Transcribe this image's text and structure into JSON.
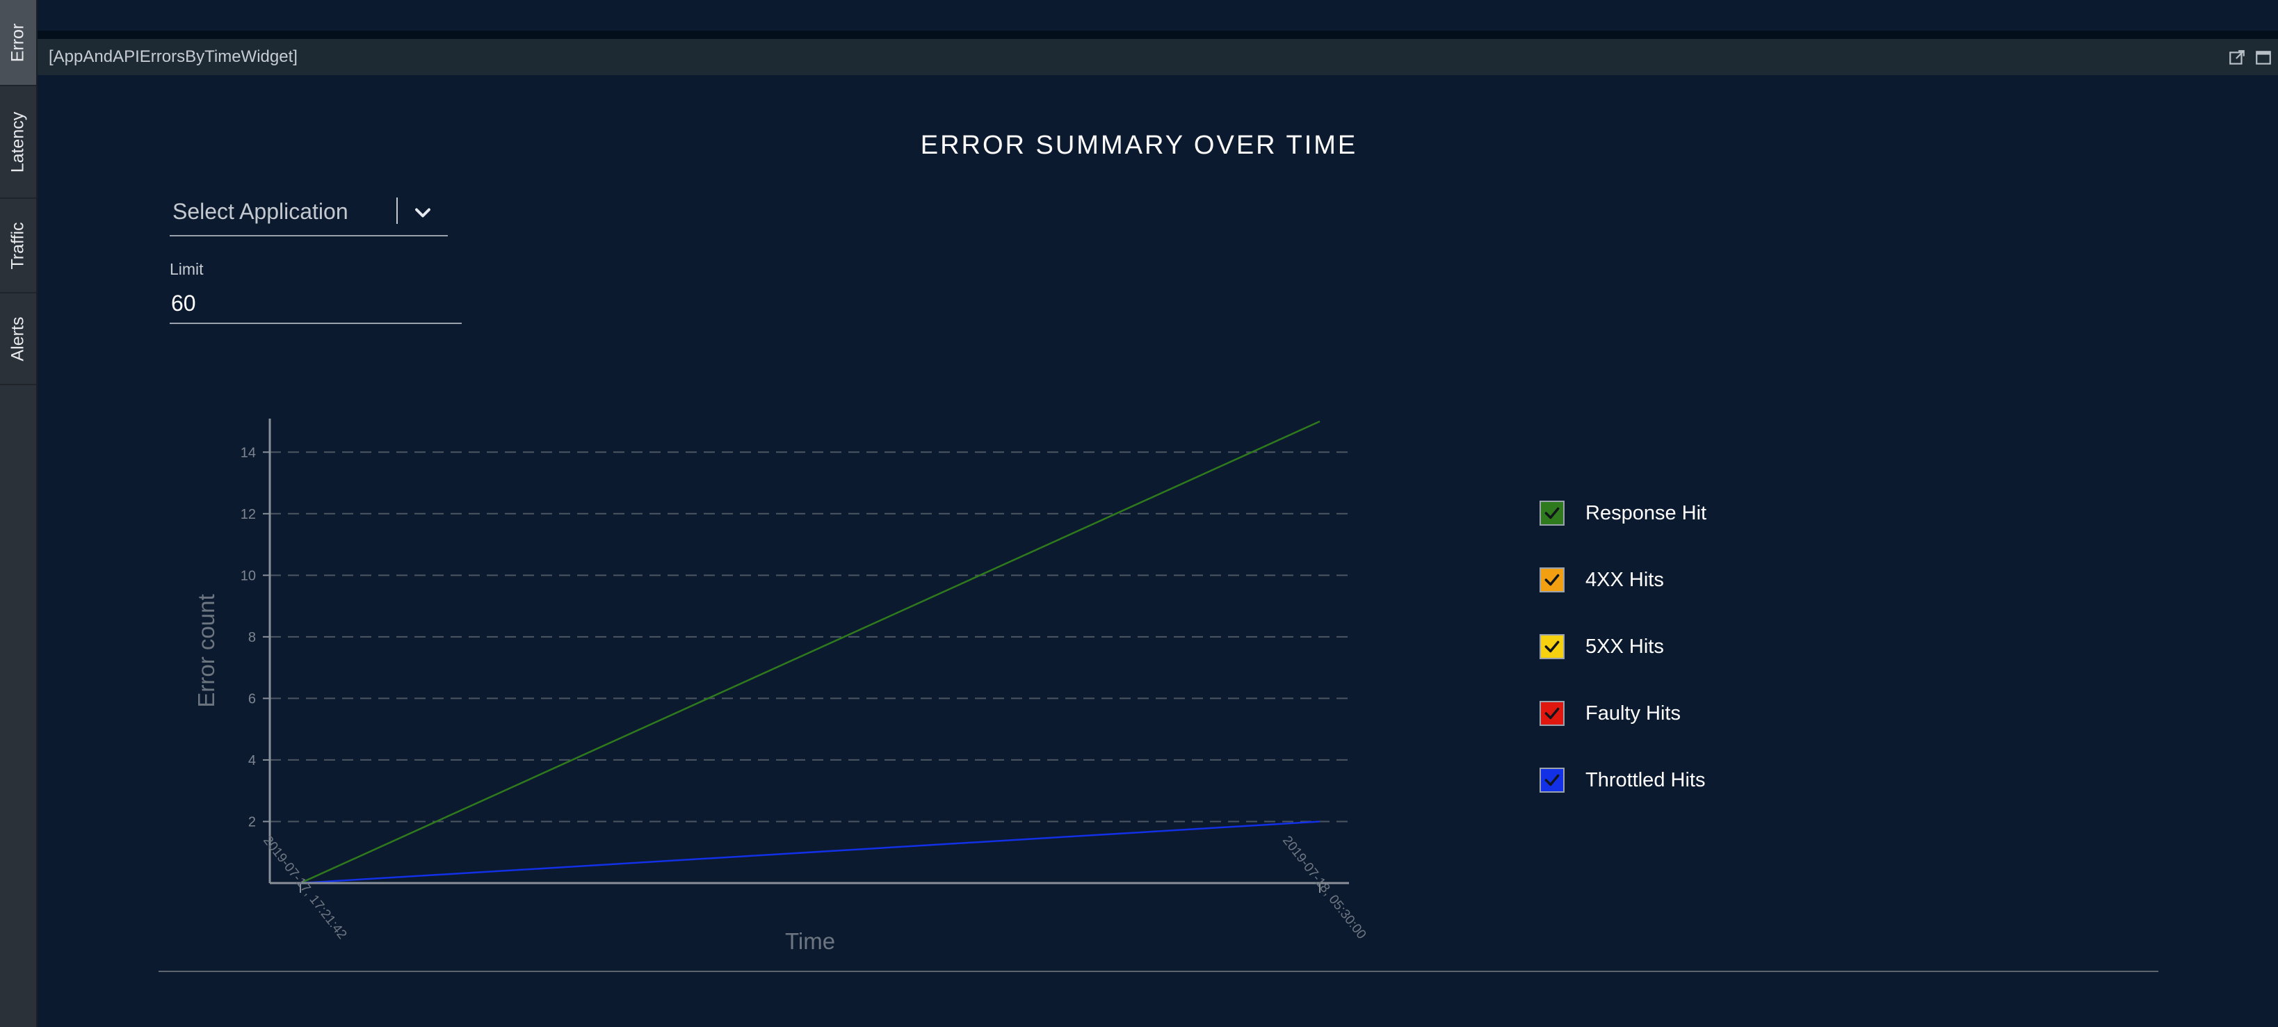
{
  "tabs": [
    {
      "label": "Error",
      "active": true
    },
    {
      "label": "Latency",
      "active": false
    },
    {
      "label": "Traffic",
      "active": false
    },
    {
      "label": "Alerts",
      "active": false
    }
  ],
  "widget": {
    "title": "[AppAndAPIErrorsByTimeWidget]",
    "icons": [
      "open-external-icon",
      "maximize-icon"
    ]
  },
  "page": {
    "title": "ERROR SUMMARY OVER TIME"
  },
  "filters": {
    "application_placeholder": "Select Application",
    "limit_label": "Limit",
    "limit_value": "60"
  },
  "legend": [
    {
      "label": "Response Hit",
      "color": "#2f7a1c"
    },
    {
      "label": "4XX Hits",
      "color": "#f2a012"
    },
    {
      "label": "5XX Hits",
      "color": "#f5d10f"
    },
    {
      "label": "Faulty Hits",
      "color": "#e0170f"
    },
    {
      "label": "Throttled Hits",
      "color": "#1230e6"
    }
  ],
  "chart_data": {
    "type": "line",
    "xlabel": "Time",
    "ylabel": "Error count",
    "ylim": [
      0,
      15
    ],
    "yticks": [
      2,
      4,
      6,
      8,
      10,
      12,
      14
    ],
    "x": [
      "2019-07-17, 17:21:42",
      "2019-07-18, 05:30:00"
    ],
    "grid": "horizontal-dashed",
    "series": [
      {
        "name": "Response Hit",
        "color": "#2f7a1c",
        "values": [
          0,
          15
        ]
      },
      {
        "name": "4XX Hits",
        "color": "#f2a012",
        "values": [
          0,
          0
        ]
      },
      {
        "name": "5XX Hits",
        "color": "#f5d10f",
        "values": [
          0,
          0
        ]
      },
      {
        "name": "Faulty Hits",
        "color": "#e0170f",
        "values": [
          0,
          0
        ]
      },
      {
        "name": "Throttled Hits",
        "color": "#1230e6",
        "values": [
          0,
          2
        ]
      }
    ]
  }
}
